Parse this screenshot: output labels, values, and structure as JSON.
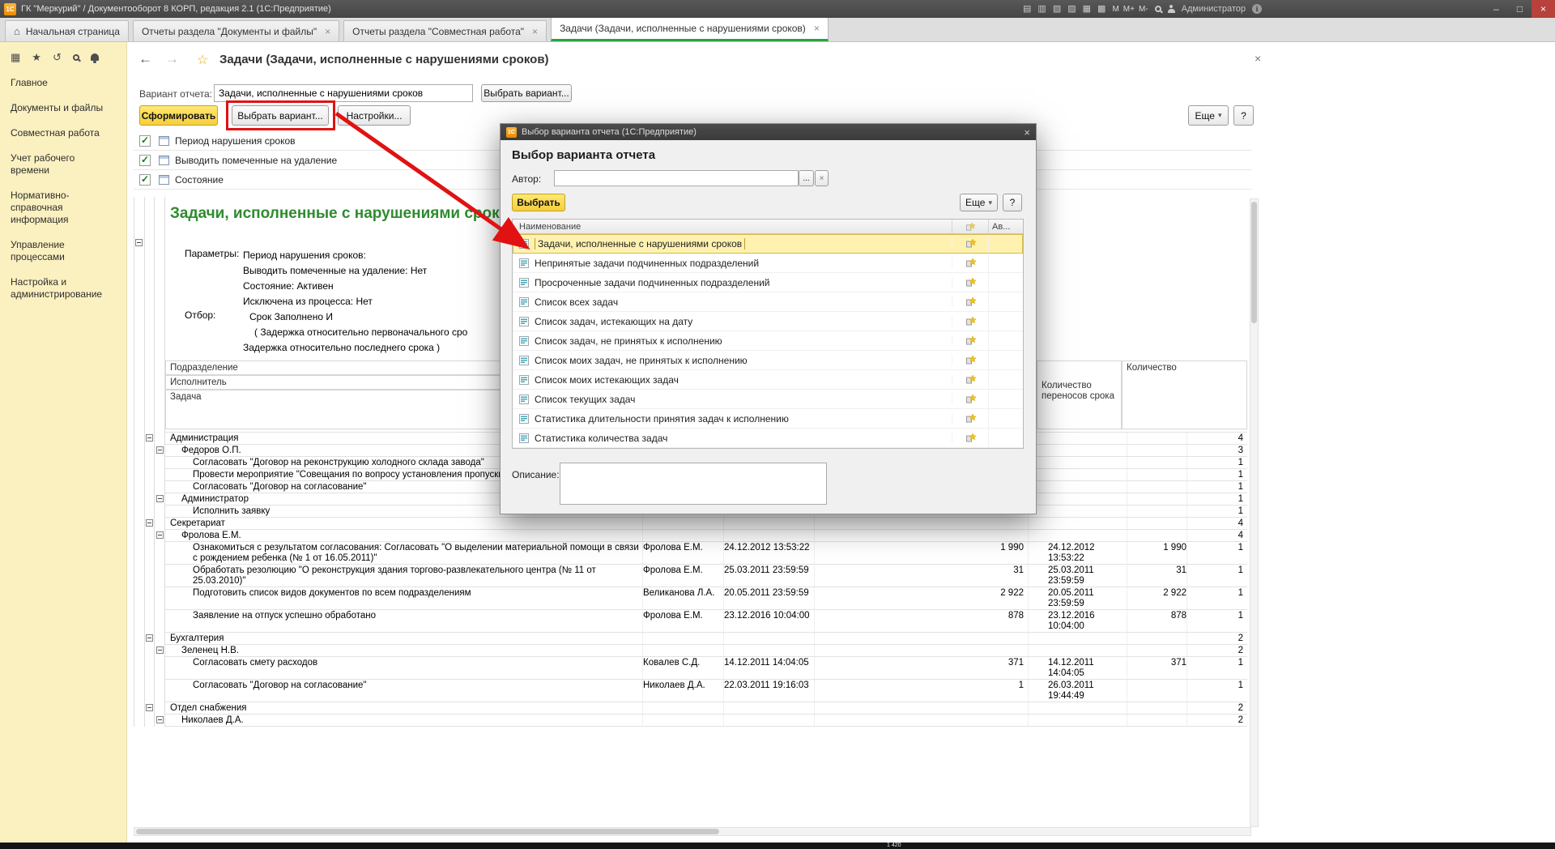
{
  "icons": {
    "logo": "1С",
    "home": "⌂",
    "close": "×",
    "minimize": "–",
    "maximize": "□",
    "back": "←",
    "forward": "→",
    "star": "★",
    "star_outline": "☆",
    "grid": "▦",
    "history": "↺",
    "check": "✓",
    "dropdown": "▾",
    "save": "▤",
    "print": "▥",
    "preview": "▧",
    "copy": "▨",
    "calendar": "▦",
    "calc": "▩",
    "info": "i"
  },
  "titlebar": {
    "title": "ГК \"Меркурий\" / Документооборот 8 КОРП, редакция 2.1  (1С:Предприятие)",
    "memory": [
      "M",
      "M+",
      "M-"
    ],
    "user": "Администратор"
  },
  "tabs": [
    {
      "label": "Начальная страница",
      "home": true,
      "active": false,
      "closable": false
    },
    {
      "label": "Отчеты раздела \"Документы и файлы\"",
      "closable": true,
      "active": false
    },
    {
      "label": "Отчеты раздела \"Совместная работа\"",
      "closable": true,
      "active": false
    },
    {
      "label": "Задачи (Задачи, исполненные с нарушениями сроков)",
      "closable": true,
      "active": true
    }
  ],
  "sidebar": {
    "items": [
      "Главное",
      "Документы и файлы",
      "Совместная работа",
      "Учет рабочего времени",
      "Нормативно-справочная информация",
      "Управление процессами",
      "Настройка и администрирование"
    ]
  },
  "page": {
    "title": "Задачи (Задачи, исполненные с нарушениями сроков)",
    "variant": {
      "label": "Вариант отчета:",
      "value": "Задачи, исполненные с нарушениями сроков",
      "button": "Выбрать вариант..."
    },
    "actions": {
      "generate": "Сформировать",
      "select_variant": "Выбрать вариант...",
      "settings": "Настройки...",
      "more": "Еще",
      "help": "?"
    },
    "quick_settings": [
      "Период нарушения сроков",
      "Выводить помеченные на удаление",
      "Состояние"
    ]
  },
  "report": {
    "title": "Задачи, исполненные с нарушениями сроков",
    "parameters_label": "Параметры:",
    "parameters": [
      "Период нарушения сроков:",
      "Выводить помеченные на удаление: Нет",
      "Состояние: Активен",
      "Исключена из процесса: Нет"
    ],
    "filter_label": "Отбор:",
    "filter": [
      "Срок Заполнено И",
      "( Задержка относительно первоначального сро",
      "Задержка относительно последнего срока )"
    ],
    "row_headers": [
      "Подразделение",
      "Исполнитель",
      "Задача"
    ],
    "col_headers": {
      "postpone": "Количество переносов срока",
      "quantity": "Количество"
    },
    "rows": [
      {
        "level": 0,
        "group": true,
        "text": "Администрация",
        "qty": "4"
      },
      {
        "level": 1,
        "group": true,
        "text": "Федоров О.П.",
        "qty": "3"
      },
      {
        "level": 2,
        "text": "Согласовать \"Договор на реконструкцию холодного склада завода\"",
        "qty": "1"
      },
      {
        "level": 2,
        "text": "Провести мероприятие \"Совещания по вопросу установления пропускного ре",
        "qty": "1"
      },
      {
        "level": 2,
        "text": "Согласовать \"Договор на согласование\"",
        "qty": "1"
      },
      {
        "level": 1,
        "group": true,
        "text": "Администратор",
        "qty": "1"
      },
      {
        "level": 2,
        "text": "Исполнить заявку",
        "qty": "1"
      },
      {
        "level": 0,
        "group": true,
        "text": "Секретариат",
        "qty": "4"
      },
      {
        "level": 1,
        "group": true,
        "text": "Фролова Е.М.",
        "qty": "4"
      },
      {
        "level": 2,
        "tall": true,
        "text": "Ознакомиться с результатом согласования: Согласовать \"О выделении материальной помощи в связи с рождением ребенка (№ 1 от 16.05.2011)\"",
        "exec": "Фролова Е.М.",
        "d1": "24.12.2012 13:53:22",
        "n1": "1 990",
        "d2": "24.12.2012 13:53:22",
        "n2": "1 990",
        "qty": "1"
      },
      {
        "level": 2,
        "tall": true,
        "text": "Обработать резолюцию \"О реконструкция здания торгово-развлекательного центра (№ 11 от 25.03.2010)\"",
        "exec": "Фролова Е.М.",
        "d1": "25.03.2011 23:59:59",
        "n1": "31",
        "d2": "25.03.2011 23:59:59",
        "n2": "31",
        "qty": "1"
      },
      {
        "level": 2,
        "text": "Подготовить список видов документов по всем подразделениям",
        "exec": "Великанова Л.А.",
        "d1": "20.05.2011 23:59:59",
        "n1": "2 922",
        "d2": "20.05.2011 23:59:59",
        "n2": "2 922",
        "qty": "1"
      },
      {
        "level": 2,
        "text": "Заявление на отпуск успешно обработано",
        "exec": "Фролова Е.М.",
        "d1": "23.12.2016 10:04:00",
        "n1": "878",
        "d2": "23.12.2016 10:04:00",
        "n2": "878",
        "qty": "1"
      },
      {
        "level": 0,
        "group": true,
        "text": "Бухгалтерия",
        "qty": "2"
      },
      {
        "level": 1,
        "group": true,
        "text": "Зеленец Н.В.",
        "qty": "2"
      },
      {
        "level": 2,
        "text": "Согласовать смету расходов",
        "exec": "Ковалев С.Д.",
        "d1": "14.12.2011 14:04:05",
        "n1": "371",
        "d2": "14.12.2011 14:04:05",
        "n2": "371",
        "qty": "1"
      },
      {
        "level": 2,
        "text": "Согласовать \"Договор на согласование\"",
        "exec": "Николаев Д.А.",
        "d1": "22.03.2011 19:16:03",
        "n1": "1",
        "d2": "26.03.2011 19:44:49",
        "n2": "",
        "qty": "1"
      },
      {
        "level": 0,
        "group": true,
        "text": "Отдел снабжения",
        "qty": "2"
      },
      {
        "level": 1,
        "group": true,
        "text": "Николаев Д.А.",
        "qty": "2"
      }
    ]
  },
  "dialog": {
    "title": "Выбор варианта отчета  (1С:Предприятие)",
    "heading": "Выбор варианта отчета",
    "author_label": "Автор:",
    "author_value": "",
    "author_pick": "...",
    "select_button": "Выбрать",
    "more_button": "Еще",
    "help_button": "?",
    "list_header": "Наименование",
    "author_col": "Ав...",
    "items": [
      {
        "label": "Задачи, исполненные с нарушениями сроков",
        "selected": true
      },
      {
        "label": "Непринятые задачи подчиненных подразделений"
      },
      {
        "label": "Просроченные задачи подчиненных подразделений"
      },
      {
        "label": "Список всех задач"
      },
      {
        "label": "Список задач, истекающих на дату"
      },
      {
        "label": "Список задач, не принятых к исполнению"
      },
      {
        "label": "Список моих задач, не принятых к исполнению"
      },
      {
        "label": "Список моих истекающих задач"
      },
      {
        "label": "Список текущих задач"
      },
      {
        "label": "Статистика длительности принятия задач к исполнению"
      },
      {
        "label": "Статистика количества задач"
      }
    ],
    "description_label": "Описание:",
    "description_value": ""
  },
  "taskbar": {
    "text": "1 420"
  }
}
